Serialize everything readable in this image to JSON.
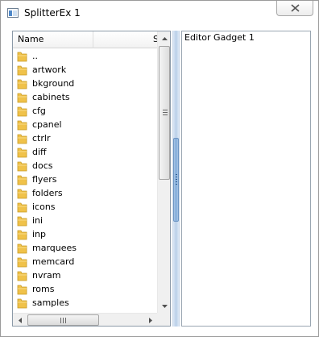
{
  "window": {
    "title": "SplitterEx 1"
  },
  "file_list": {
    "columns": [
      "Name",
      "S"
    ],
    "items": [
      "..",
      "artwork",
      "bkground",
      "cabinets",
      "cfg",
      "cpanel",
      "ctrlr",
      "diff",
      "docs",
      "flyers",
      "folders",
      "icons",
      "ini",
      "inp",
      "marquees",
      "memcard",
      "nvram",
      "roms",
      "samples"
    ],
    "item_icon": "folder-icon"
  },
  "editor": {
    "text": "Editor Gadget 1"
  },
  "colors": {
    "folder": "#f0c24a",
    "splitter": "#8fb3de"
  }
}
